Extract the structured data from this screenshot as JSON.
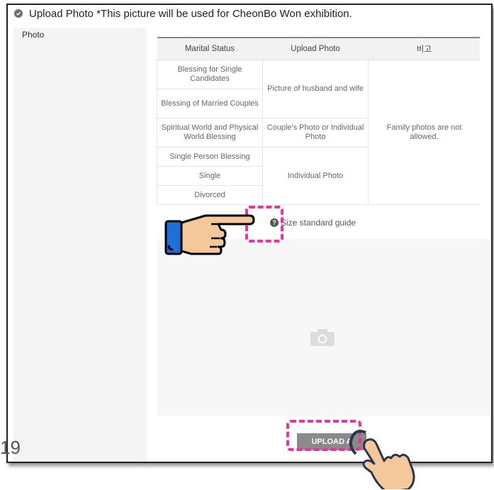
{
  "header": {
    "title": "Upload Photo *This picture will be used for CheonBo Won exhibition."
  },
  "photo_label": "Photo",
  "table": {
    "headers": [
      "Marital Status",
      "Upload Photo",
      "비고"
    ],
    "rows": [
      "Blessing for Single Candidates",
      "Blessing of Married Couples",
      "Spiritual World and Physical World Blessing",
      "Single Person Blessing",
      "Single",
      "Divorced"
    ],
    "photo_types": [
      "Picture of husband and wife",
      "Couple's Photo or Individual Photo",
      "Individual Photo"
    ],
    "note": "Family photos are not allowed."
  },
  "guide_text": "Size standard guide",
  "upload_button": "UPLOAD A",
  "page_number": "19",
  "icons": [
    "check-circle-icon",
    "help-icon",
    "camera-icon",
    "pointing-hand-icon",
    "tapping-hand-icon"
  ],
  "colors": {
    "highlight": "#e8339a",
    "button": "#8a8a8a"
  }
}
